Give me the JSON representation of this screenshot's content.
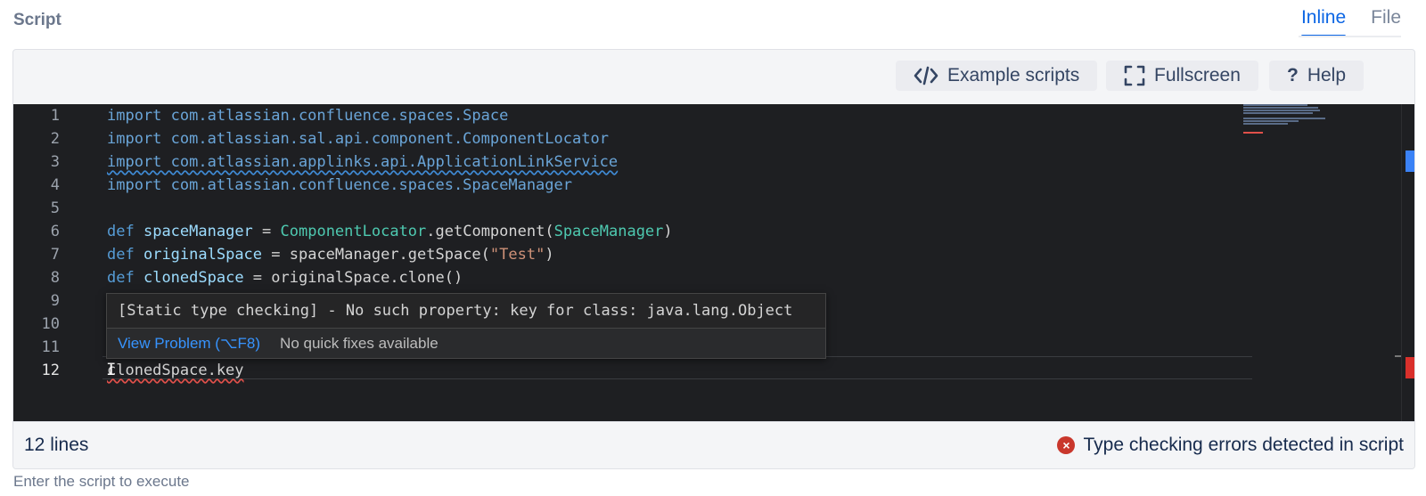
{
  "section_label": "Script",
  "mode_tabs": [
    {
      "label": "Inline",
      "active": true
    },
    {
      "label": "File",
      "active": false
    }
  ],
  "toolbar": {
    "example_scripts": "Example scripts",
    "fullscreen": "Fullscreen",
    "help": "Help"
  },
  "editor": {
    "line_numbers": [
      "1",
      "2",
      "3",
      "4",
      "5",
      "6",
      "7",
      "8",
      "9",
      "10",
      "11",
      "12"
    ],
    "lines": {
      "l1_kw": "import",
      "l1_rest": " com.atlassian.confluence.spaces.Space",
      "l2_kw": "import",
      "l2_rest": " com.atlassian.sal.api.component.ComponentLocator",
      "l3_text": "import com.atlassian.applinks.api.ApplicationLinkService",
      "l4_kw": "import",
      "l4_rest": " com.atlassian.confluence.spaces.SpaceManager",
      "l6_kw": "def",
      "l6_var": "spaceManager",
      "l6_eq": " = ",
      "l6_cls": "ComponentLocator",
      "l6_mid": ".getComponent(",
      "l6_arg": "SpaceManager",
      "l6_end": ")",
      "l7_kw": "def",
      "l7_var": "originalSpace",
      "l7_mid": " = spaceManager.getSpace(",
      "l7_str": "\"Test\"",
      "l7_end": ")",
      "l8_kw": "def",
      "l8_var": "clonedSpace",
      "l8_mid": " = originalSpace.clone()",
      "l12_text": "clonedSpace.key"
    },
    "hover": {
      "message": "[Static type checking] - No such property: key for class: java.lang.Object",
      "view_problem": "View Problem (⌥F8)",
      "no_fixes": "No quick fixes available"
    }
  },
  "status": {
    "line_count": "12 lines",
    "error_message": "Type checking errors detected in script"
  },
  "hint": "Enter the script to execute",
  "colors": {
    "accent": "#0c66e4",
    "editor_bg": "#1e1f22",
    "error": "#c9372c"
  }
}
